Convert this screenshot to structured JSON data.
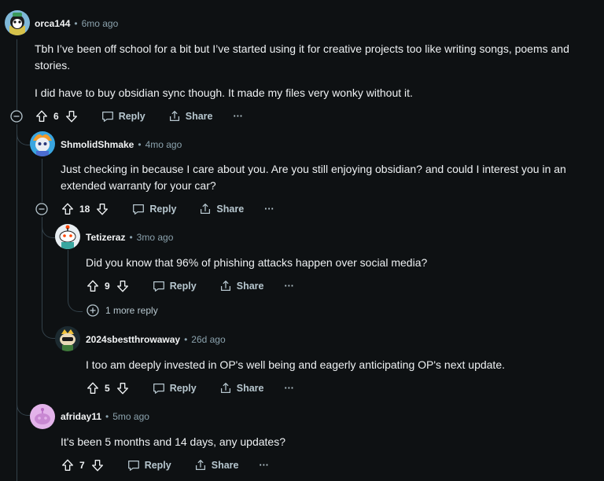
{
  "actions": {
    "reply_label": "Reply",
    "share_label": "Share",
    "more_label": "···"
  },
  "comments": [
    {
      "user": "orca144",
      "time": "6mo ago",
      "text_p1": "Tbh I’ve been off school for a bit but I’ve started using it for creative projects too like writing songs, poems and stories.",
      "text_p2": "I did have to buy obsidian sync though. It made my files very wonky without it.",
      "votes": "6"
    },
    {
      "user": "ShmolidShmake",
      "time": "4mo ago",
      "text": "Just checking in because I care about you. Are you still enjoying obsidian? and could I interest you in an extended warranty for your car?",
      "votes": "18"
    },
    {
      "user": "Tetizeraz",
      "time": "3mo ago",
      "text": "Did you know that 96% of phishing attacks happen over social media?",
      "votes": "9"
    },
    {
      "user": "2024sbestthrowaway",
      "time": "26d ago",
      "text": "I too am deeply invested in OP's well being and eagerly anticipating OP's next update.",
      "votes": "5"
    },
    {
      "user": "afriday11",
      "time": "5mo ago",
      "text": "It's been 5 months and 14 days, any updates?",
      "votes": "7"
    }
  ],
  "more_replies": "1 more reply",
  "icons": {
    "upvote": "upvote-icon",
    "downvote": "downvote-icon",
    "reply": "comment-bubble-icon",
    "share": "share-icon",
    "collapse": "collapse-minus-icon",
    "expand": "expand-plus-icon"
  }
}
